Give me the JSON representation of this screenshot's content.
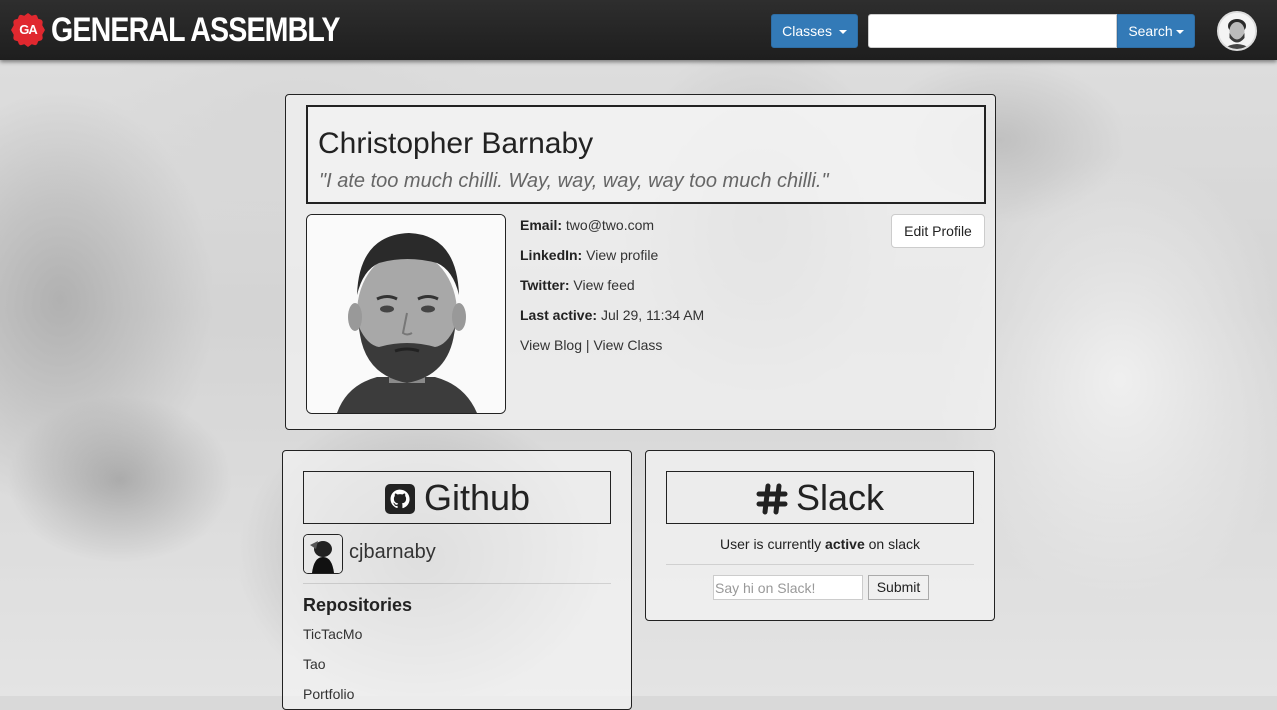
{
  "brand": {
    "badge": "GA",
    "name": "GENERAL ASSEMBLY",
    "accent": "#e0282f"
  },
  "nav": {
    "classes_label": "Classes",
    "search_placeholder": "",
    "search_label": "Search",
    "button_color": "#337ab7"
  },
  "profile": {
    "name": "Christopher Barnaby",
    "quote": "\"I ate too much chilli. Way, way, way, way too much chilli.\"",
    "edit_label": "Edit Profile",
    "email_label": "Email:",
    "email_value": "two@two.com",
    "linkedin_label": "LinkedIn:",
    "linkedin_value": "View profile",
    "twitter_label": "Twitter:",
    "twitter_value": "View feed",
    "last_active_label": "Last active:",
    "last_active_value": "Jul 29, 11:34 AM",
    "blog_link": "View Blog",
    "separator": "|",
    "class_link": "View Class"
  },
  "github": {
    "title": "Github",
    "icon": "github-icon",
    "username": "cjbarnaby",
    "repos_title": "Repositories",
    "repos": [
      "TicTacMo",
      "Tao",
      "Portfolio"
    ]
  },
  "slack": {
    "title": "Slack",
    "icon": "slack-hash-icon",
    "status_prefix": "User is currently",
    "status_value": "active",
    "status_suffix": "on slack",
    "input_placeholder": "Say hi on Slack!",
    "submit_label": "Submit"
  }
}
